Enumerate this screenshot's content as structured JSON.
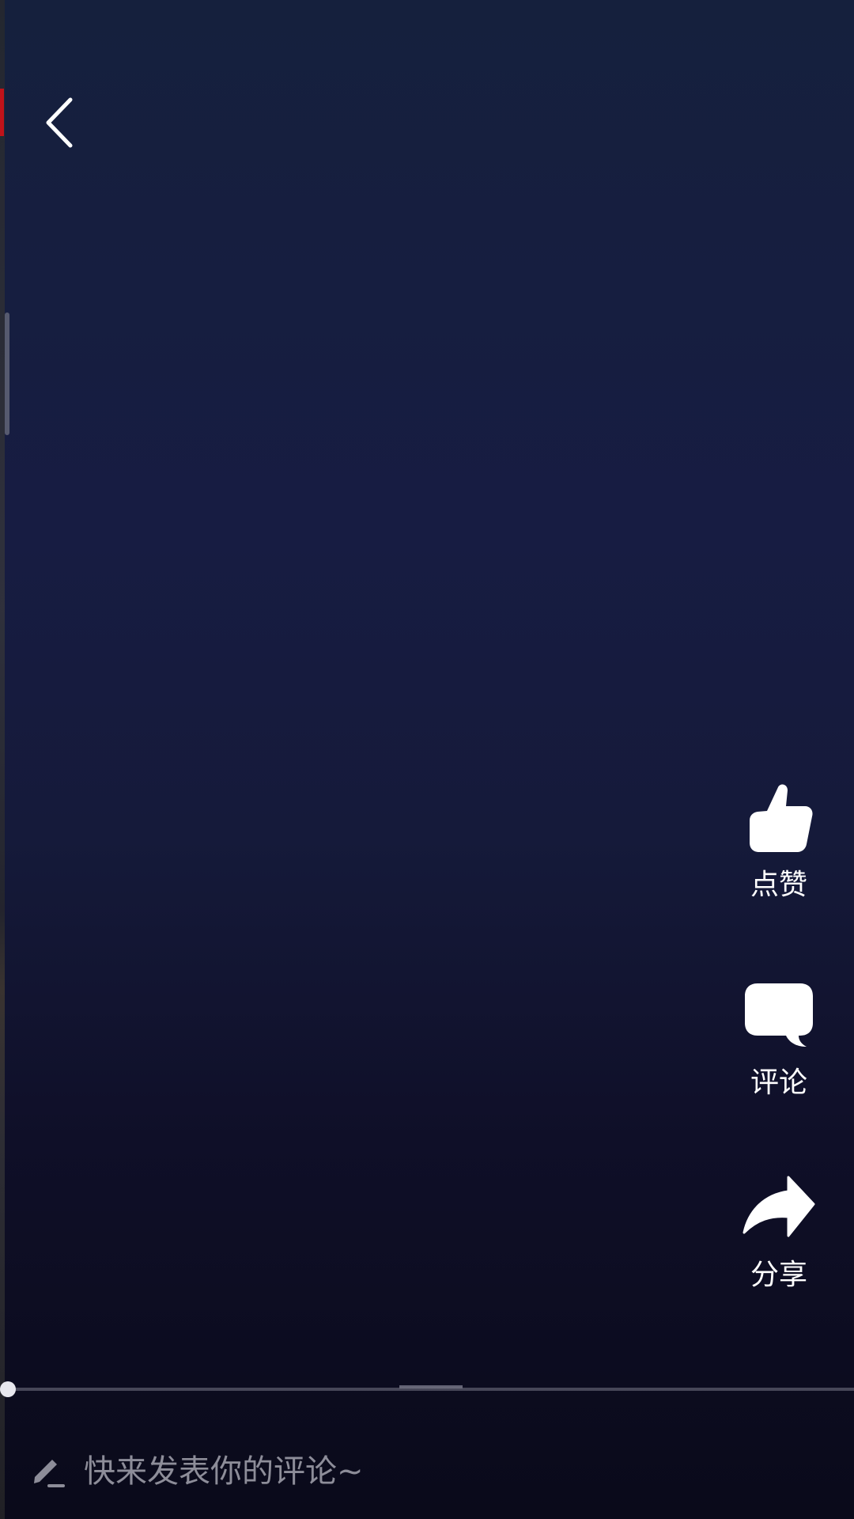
{
  "actions": {
    "like_label": "点赞",
    "comment_label": "评论",
    "share_label": "分享"
  },
  "comment_input": {
    "placeholder": "快来发表你的评论~"
  },
  "player": {
    "progress": 0
  },
  "icons": {
    "back": "back-arrow-icon",
    "like": "thumbs-up-icon",
    "comment": "speech-bubble-icon",
    "share": "share-arrow-icon",
    "edit": "pencil-icon"
  },
  "colors": {
    "background_top": "#15203d",
    "background_bottom": "#0a0a1a",
    "icon": "#ffffff",
    "placeholder_text": "#8d8d99"
  }
}
